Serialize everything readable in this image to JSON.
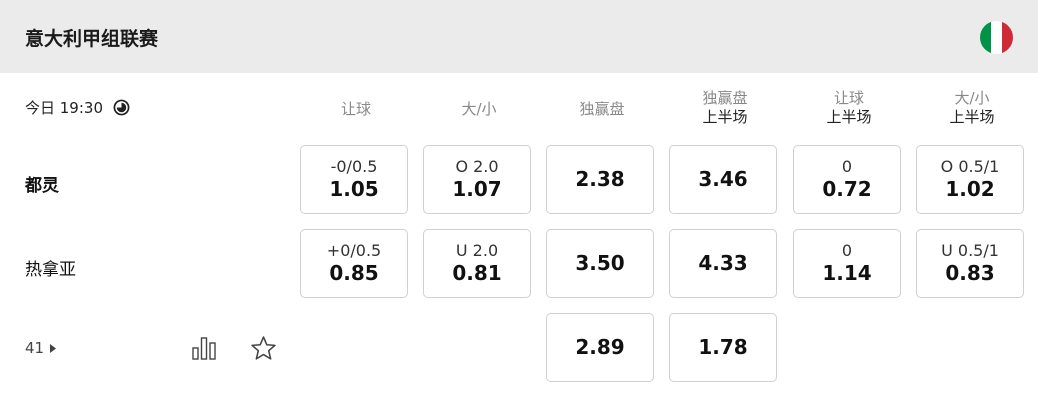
{
  "header": {
    "league": "意大利甲组联赛",
    "flag": {
      "name": "italy-flag",
      "colors": [
        "#009246",
        "#ffffff",
        "#ce2b37"
      ]
    }
  },
  "match": {
    "time": "今日 19:30",
    "clock_icon": "clock-icon"
  },
  "columns": [
    {
      "top": "",
      "label": "让球"
    },
    {
      "top": "",
      "label": "大/小"
    },
    {
      "top": "",
      "label": "独赢盘"
    },
    {
      "top": "独赢盘",
      "label": "上半场"
    },
    {
      "top": "让球",
      "label": "上半场"
    },
    {
      "top": "大/小",
      "label": "上半场"
    }
  ],
  "teams": [
    {
      "name": "都灵",
      "odds": [
        {
          "line": "-0/0.5",
          "price": "1.05"
        },
        {
          "line": "O 2.0",
          "price": "1.07"
        },
        {
          "line": "",
          "price": "2.38"
        },
        {
          "line": "",
          "price": "3.46"
        },
        {
          "line": "0",
          "price": "0.72"
        },
        {
          "line": "O 0.5/1",
          "price": "1.02"
        }
      ]
    },
    {
      "name": "热拿亚",
      "odds": [
        {
          "line": "+0/0.5",
          "price": "0.85"
        },
        {
          "line": "U 2.0",
          "price": "0.81"
        },
        {
          "line": "",
          "price": "3.50"
        },
        {
          "line": "",
          "price": "4.33"
        },
        {
          "line": "0",
          "price": "1.14"
        },
        {
          "line": "U 0.5/1",
          "price": "0.83"
        }
      ]
    }
  ],
  "draw": {
    "odds": [
      {
        "price": "2.89"
      },
      {
        "price": "1.78"
      }
    ]
  },
  "footer": {
    "more_markets": "41",
    "stats_icon": "stats-icon",
    "favorite_icon": "star-icon"
  }
}
